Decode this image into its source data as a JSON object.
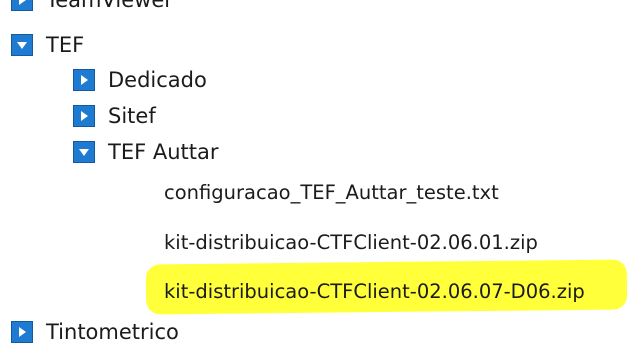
{
  "tree": {
    "cut_item": {
      "label": "TeamViewer",
      "icon": "expand-arrow-right-icon"
    },
    "tef": {
      "label": "TEF",
      "icon": "collapse-arrow-down-icon",
      "children": {
        "dedicado": {
          "label": "Dedicado",
          "icon": "expand-arrow-right-icon"
        },
        "sitef": {
          "label": "Sitef",
          "icon": "expand-arrow-right-icon"
        },
        "tef_auttar": {
          "label": "TEF Auttar",
          "icon": "collapse-arrow-down-icon",
          "files": [
            "configuracao_TEF_Auttar_teste.txt",
            "kit-distribuicao-CTFClient-02.06.01.zip",
            "kit-distribuicao-CTFClient-02.06.07-D06.zip"
          ]
        }
      }
    },
    "tintometrico": {
      "label": "Tintometrico",
      "icon": "expand-arrow-right-icon"
    }
  },
  "colors": {
    "toggle_fill": "#1f7ad1",
    "highlight": "#ffff3a",
    "text": "#1b1b1b"
  }
}
